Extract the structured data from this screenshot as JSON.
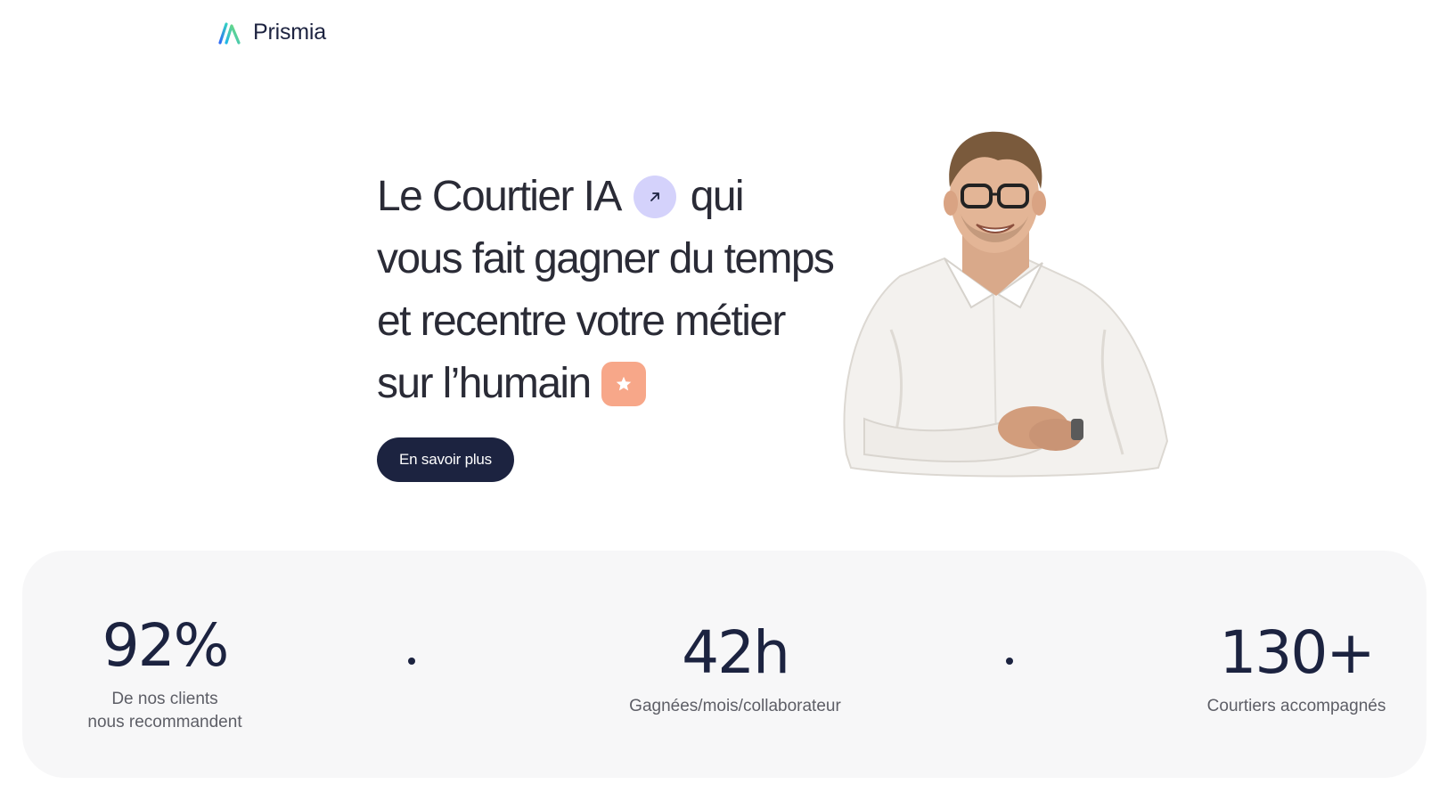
{
  "header": {
    "brand": "Prismia",
    "logo_icon": "prism-logo-icon"
  },
  "hero": {
    "line1_a": "Le Courtier IA",
    "line1_b": "qui",
    "line2": "vous fait gagner du temps",
    "line3": "et recentre votre métier",
    "line4": "sur l’humain",
    "arrow_badge_icon": "arrow-up-right-icon",
    "star_badge_icon": "star-icon",
    "cta_label": "En savoir plus"
  },
  "stats": [
    {
      "value": "92%",
      "label_line1": "De nos clients",
      "label_line2": "nous recommandent"
    },
    {
      "value": "42h",
      "label_line1": "Gagnées/mois/collaborateur"
    },
    {
      "value": "130+",
      "label_line1": "Courtiers accompagnés"
    }
  ],
  "colors": {
    "navy": "#1c2340",
    "lavender_badge": "#d4d2fb",
    "peach_badge": "#f7a789",
    "stats_background": "#f7f7f8"
  }
}
